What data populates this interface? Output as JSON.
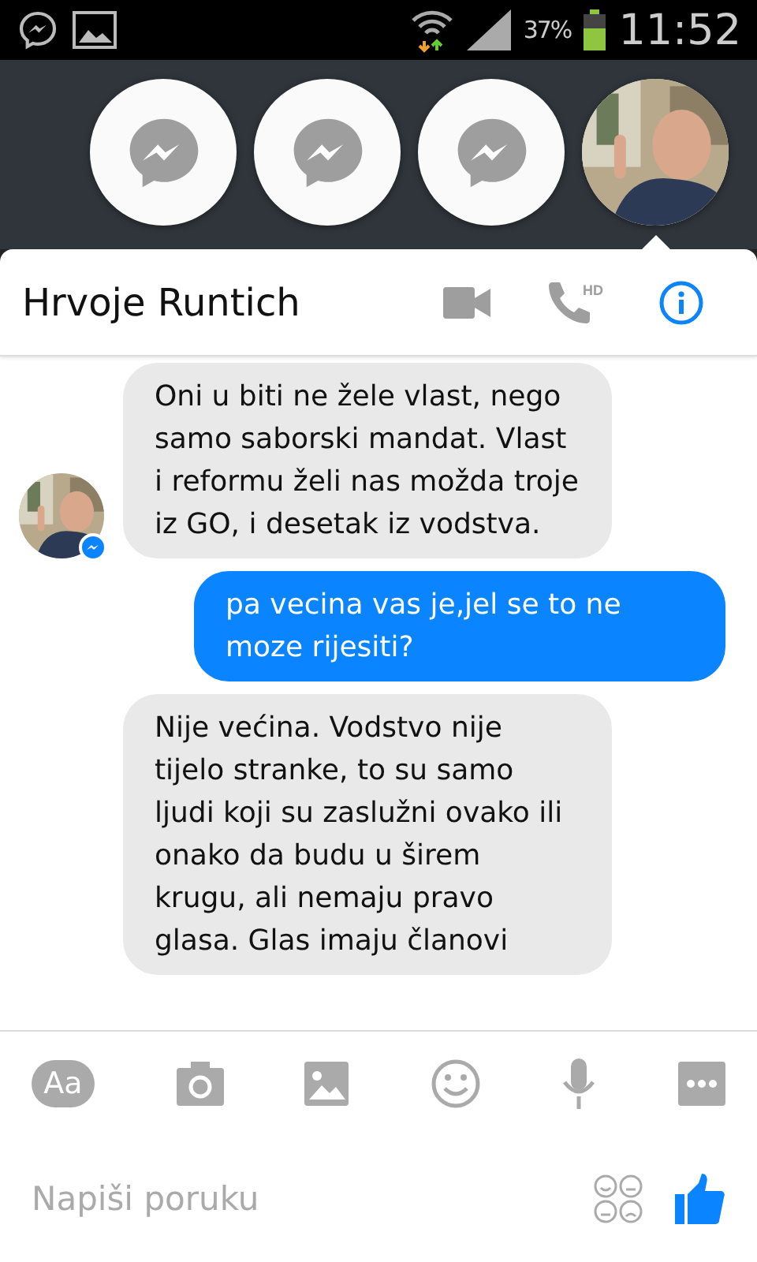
{
  "status_bar": {
    "battery": "37%",
    "time": "11:52"
  },
  "chat_heads": [
    {
      "kind": "messenger",
      "selected": false
    },
    {
      "kind": "messenger",
      "selected": false
    },
    {
      "kind": "messenger",
      "selected": false
    },
    {
      "kind": "avatar",
      "selected": true
    }
  ],
  "header": {
    "title": "Hrvoje Runtich",
    "call_badge": "HD"
  },
  "messages": [
    {
      "kind": "received",
      "avatar": true,
      "text": "Oni u biti ne žele vlast, nego samo saborski mandat. Vlast i reformu želi nas možda troje iz GO, i desetak iz vodstva."
    },
    {
      "kind": "sent",
      "text": "pa vecina vas je,jel se to ne moze rijesiti?"
    },
    {
      "kind": "received",
      "avatar": false,
      "text": "Nije većina. Vodstvo nije tijelo stranke, to su samo ljudi koji su zaslužni ovako ili onako da budu u širem krugu, ali nemaju pravo glasa. Glas imaju članovi"
    }
  ],
  "composer": {
    "text_button": "Aa",
    "placeholder": "Napiši poruku"
  }
}
